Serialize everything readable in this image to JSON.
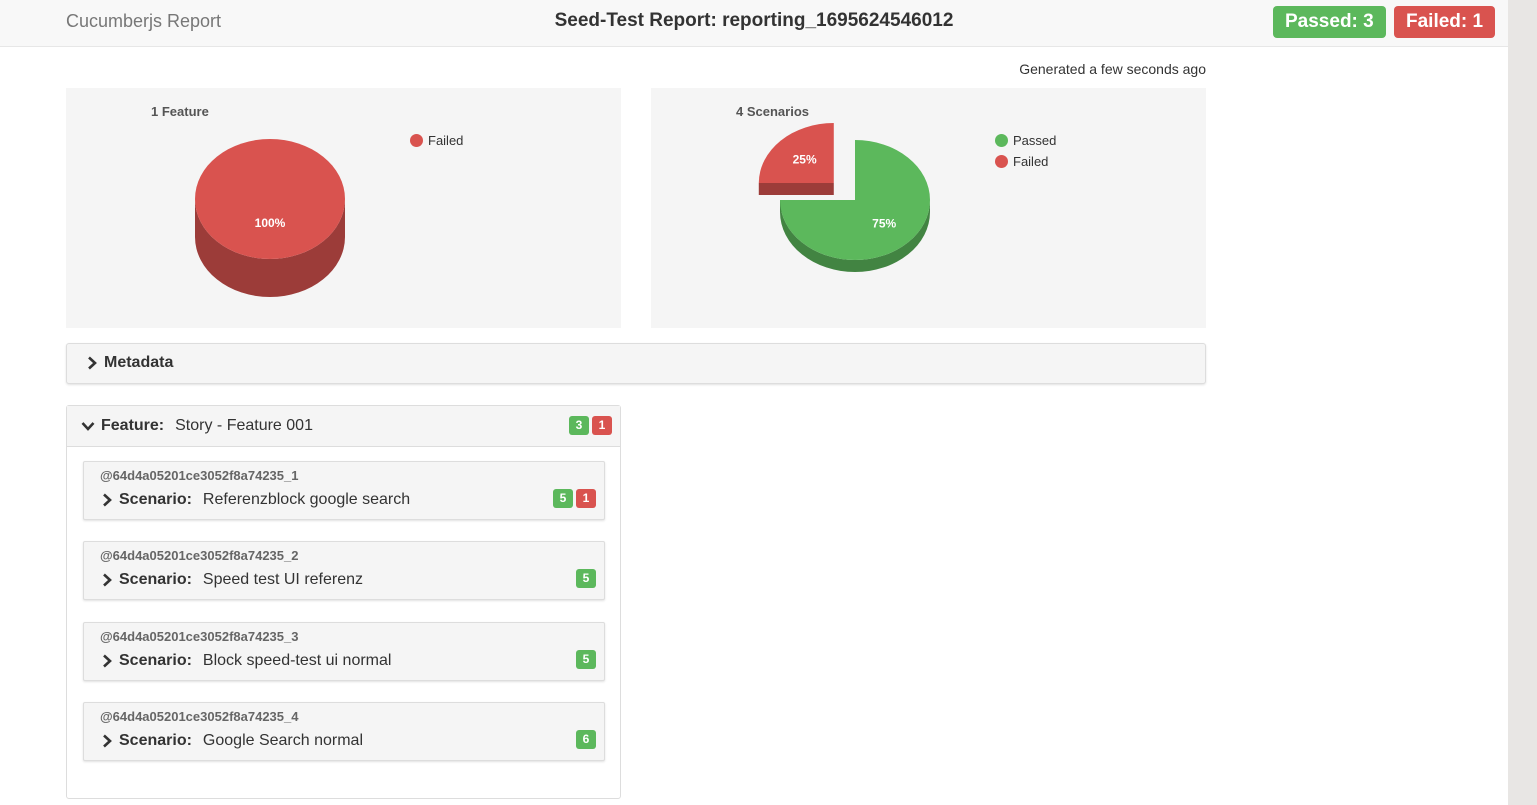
{
  "header": {
    "brand": "Cucumberjs Report",
    "title": "Seed-Test Report: reporting_1695624546012",
    "passed_label": "Passed: 3",
    "failed_label": "Failed: 1"
  },
  "generated": "Generated a few seconds ago",
  "colors": {
    "passed": "#5cb85c",
    "failed": "#d9534f"
  },
  "chart_data": [
    {
      "type": "pie",
      "title": "1 Feature",
      "labels": [
        "Failed"
      ],
      "values": [
        100
      ],
      "value_labels": [
        "100%"
      ],
      "colors": [
        "#d9534f"
      ],
      "legend_position": "right"
    },
    {
      "type": "pie",
      "title": "4 Scenarios",
      "labels": [
        "Passed",
        "Failed"
      ],
      "values": [
        75,
        25
      ],
      "value_labels": [
        "75%",
        "25%"
      ],
      "colors": [
        "#5cb85c",
        "#d9534f"
      ],
      "legend_position": "right"
    }
  ],
  "metadata": {
    "label": "Metadata"
  },
  "feature": {
    "keyword": "Feature:",
    "name": "Story - Feature 001",
    "passed": "3",
    "failed": "1"
  },
  "scenarios": [
    {
      "tag": "@64d4a05201ce3052f8a74235_1",
      "keyword": "Scenario:",
      "name": "Referenzblock google search",
      "passed": "5",
      "failed": "1"
    },
    {
      "tag": "@64d4a05201ce3052f8a74235_2",
      "keyword": "Scenario:",
      "name": "Speed test UI referenz",
      "passed": "5"
    },
    {
      "tag": "@64d4a05201ce3052f8a74235_3",
      "keyword": "Scenario:",
      "name": "Block speed-test ui normal",
      "passed": "5"
    },
    {
      "tag": "@64d4a05201ce3052f8a74235_4",
      "keyword": "Scenario:",
      "name": "Google Search normal",
      "passed": "6"
    }
  ]
}
